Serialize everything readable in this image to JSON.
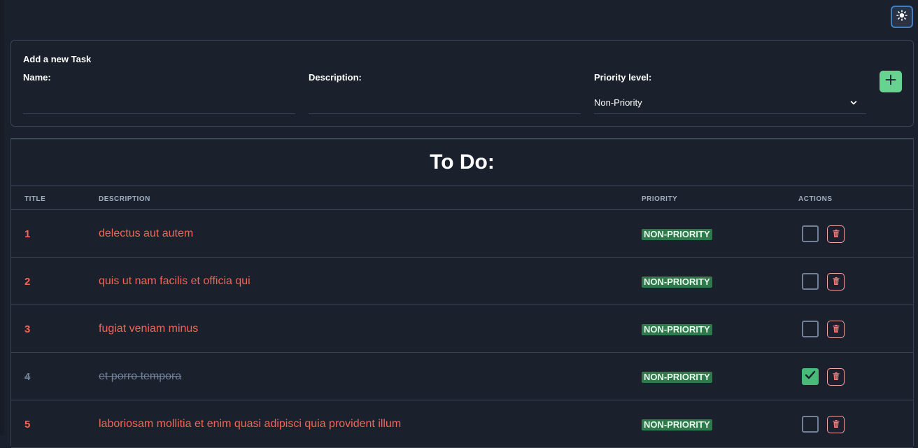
{
  "theme_toggle": {
    "icon": "sun-icon"
  },
  "form": {
    "title": "Add a new Task",
    "name_label": "Name:",
    "name_value": "",
    "description_label": "Description:",
    "description_value": "",
    "priority_label": "Priority level:",
    "priority_value": "Non-Priority",
    "add_icon": "plus-icon"
  },
  "table": {
    "title": "To Do:",
    "columns": {
      "title": "TITLE",
      "description": "DESCRIPTION",
      "priority": "PRIORITY",
      "actions": "ACTIONS"
    },
    "rows": [
      {
        "title": "1",
        "description": "delectus aut autem",
        "priority": "NON-PRIORITY",
        "completed": false
      },
      {
        "title": "2",
        "description": "quis ut nam facilis et officia qui",
        "priority": "NON-PRIORITY",
        "completed": false
      },
      {
        "title": "3",
        "description": "fugiat veniam minus",
        "priority": "NON-PRIORITY",
        "completed": false
      },
      {
        "title": "4",
        "description": "et porro tempora",
        "priority": "NON-PRIORITY",
        "completed": true
      },
      {
        "title": "5",
        "description": "laboriosam mollitia et enim quasi adipisci quia provident illum",
        "priority": "NON-PRIORITY",
        "completed": false
      }
    ]
  },
  "colors": {
    "background": "#1a202c",
    "incomplete_text": "#f56555",
    "completed_text": "#718096",
    "badge_bg": "#2f7a4d",
    "add_button": "#68d391",
    "checked": "#48bb78"
  }
}
